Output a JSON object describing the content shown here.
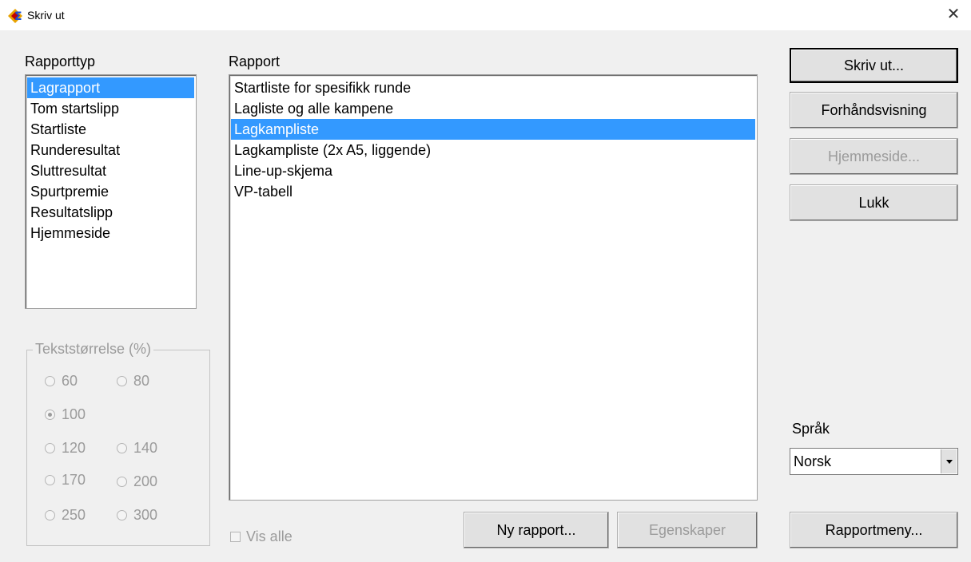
{
  "window": {
    "title": "Skriv ut",
    "close_glyph": "✕"
  },
  "rapporttyp": {
    "label": "Rapporttyp",
    "items": [
      {
        "label": "Lagrapport",
        "selected": true
      },
      {
        "label": "Tom startslipp",
        "selected": false
      },
      {
        "label": "Startliste",
        "selected": false
      },
      {
        "label": "Runderesultat",
        "selected": false
      },
      {
        "label": "Sluttresultat",
        "selected": false
      },
      {
        "label": "Spurtpremie",
        "selected": false
      },
      {
        "label": "Resultatslipp",
        "selected": false
      },
      {
        "label": "Hjemmeside",
        "selected": false
      }
    ]
  },
  "rapport": {
    "label": "Rapport",
    "items": [
      {
        "label": "Startliste for spesifikk runde",
        "selected": false
      },
      {
        "label": "Lagliste og alle kampene",
        "selected": false
      },
      {
        "label": "Lagkampliste",
        "selected": true
      },
      {
        "label": "Lagkampliste (2x A5, liggende)",
        "selected": false
      },
      {
        "label": "Line-up-skjema",
        "selected": false
      },
      {
        "label": "VP-tabell",
        "selected": false
      }
    ]
  },
  "text_size": {
    "title": "Tekststørrelse (%)",
    "options": [
      "60",
      "80",
      "100",
      "120",
      "140",
      "170",
      "200",
      "250",
      "300"
    ],
    "selected": "100"
  },
  "vis_alle": {
    "label": "Vis alle",
    "checked": false
  },
  "buttons": {
    "print": "Skriv ut...",
    "preview": "Forhåndsvisning",
    "homepage": "Hjemmeside...",
    "close": "Lukk",
    "new_report": "Ny rapport...",
    "properties": "Egenskaper",
    "report_menu": "Rapportmeny..."
  },
  "language": {
    "label": "Språk",
    "value": "Norsk"
  },
  "colors": {
    "selection": "#3399ff",
    "disabled_text": "#9b9b9b",
    "dialog_bg": "#f0f0f0"
  },
  "icons": {
    "app": "sigma-app-icon",
    "close": "close-icon",
    "dropdown": "chevron-down-icon"
  }
}
